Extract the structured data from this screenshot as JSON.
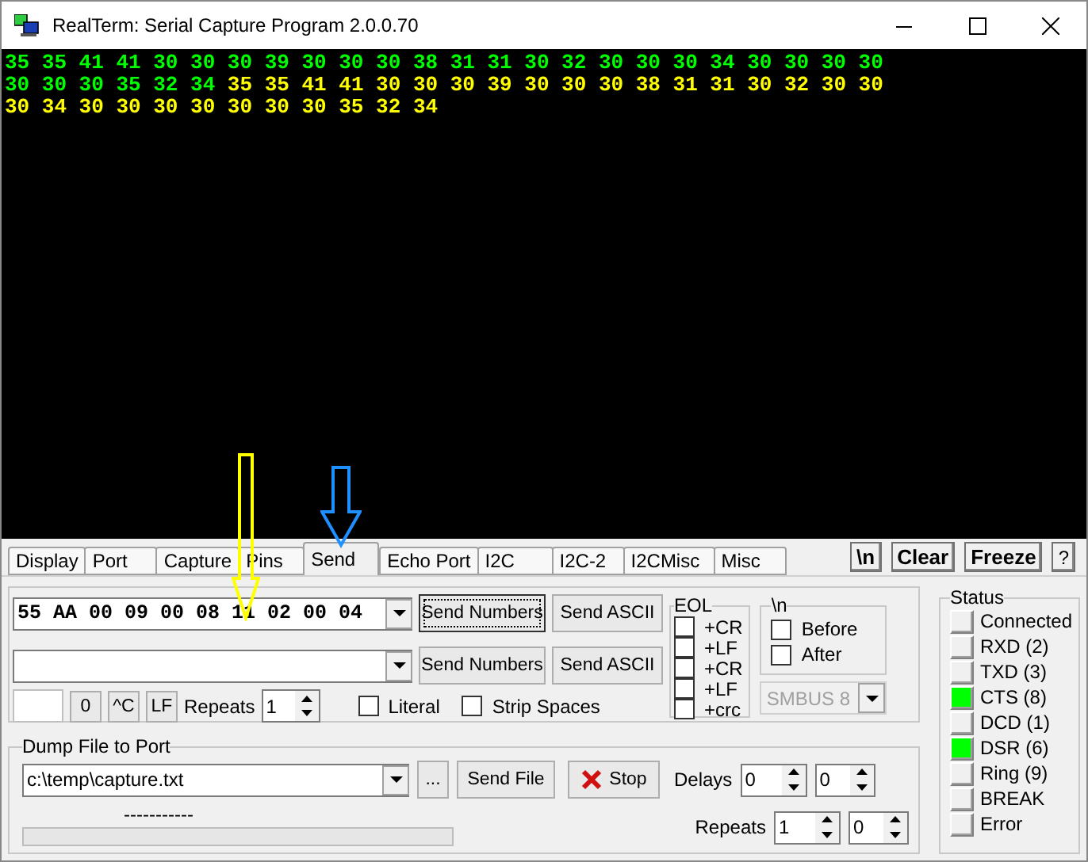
{
  "window": {
    "title": "RealTerm: Serial Capture Program 2.0.0.70"
  },
  "terminal": {
    "lines": [
      [
        {
          "text": "35 35 41 41 30 30 30 39 30 30 30 38 31 31 30 32 30 30 30 34 30 30 30 30",
          "color": "#00ff00"
        }
      ],
      [
        {
          "text": "30 30 30 35 32 34",
          "color": "#00ff00"
        },
        {
          "text": " 35 35 41 41 30 30 30 39 30 30 30 38 31 31 30 32 30 30",
          "color": "#ffff00"
        }
      ],
      [
        {
          "text": "30 34 30 30 30 30 30 30 30 35 32 34",
          "color": "#ffff00"
        }
      ]
    ]
  },
  "annotations": [
    {
      "color": "#ffff00"
    },
    {
      "color": "#1e90ff"
    }
  ],
  "tabs": [
    {
      "label": "Display",
      "selected": false
    },
    {
      "label": "Port",
      "selected": false
    },
    {
      "label": "Capture",
      "selected": false
    },
    {
      "label": "Pins",
      "selected": false
    },
    {
      "label": "Send",
      "selected": true
    },
    {
      "label": "Echo Port",
      "selected": false
    },
    {
      "label": "I2C",
      "selected": false
    },
    {
      "label": "I2C-2",
      "selected": false
    },
    {
      "label": "I2CMisc",
      "selected": false
    },
    {
      "label": "Misc",
      "selected": false
    }
  ],
  "toolbar_buttons": [
    "\\n",
    "Clear",
    "Freeze",
    "?"
  ],
  "send_rows": [
    {
      "value": "55 AA 00 09 00 08 11 02 00 04",
      "buttons": [
        {
          "label": "Send Numbers",
          "focused": true
        },
        {
          "label": "Send ASCII",
          "focused": false
        }
      ]
    },
    {
      "buttons": [
        {
          "label": "Send Numbers",
          "focused": false
        },
        {
          "label": "Send ASCII",
          "focused": false
        }
      ]
    }
  ],
  "control_chars": {
    "buttons": [
      "0",
      "^C",
      "LF"
    ],
    "repeats_label": "Repeats",
    "repeats": "1"
  },
  "options": [
    {
      "label": "Literal",
      "checked": false
    },
    {
      "label": "Strip Spaces",
      "checked": false
    }
  ],
  "eol": {
    "title": "EOL",
    "items": [
      {
        "label": "+CR",
        "checked": false
      },
      {
        "label": "+LF",
        "checked": false
      },
      {
        "label": "+CR",
        "checked": false
      },
      {
        "label": "+LF",
        "checked": false
      },
      {
        "label": "+crc",
        "checked": false
      }
    ]
  },
  "newline": {
    "title": "\\n",
    "items": [
      {
        "label": "Before",
        "checked": false
      },
      {
        "label": "After",
        "checked": false
      }
    ]
  },
  "smbus": {
    "value": "SMBUS 8",
    "disabled": true
  },
  "dump": {
    "title": "Dump File to Port",
    "file": "c:\\temp\\capture.txt",
    "browse": "...",
    "send_file": "Send File",
    "stop": "Stop",
    "delays_label": "Delays",
    "delays": [
      "0",
      "0"
    ],
    "progress_text": "-----------",
    "progress": {
      "level": 0
    },
    "repeats_label": "Repeats",
    "repeats": [
      "1",
      "0"
    ]
  },
  "status": {
    "title": "Status",
    "items": [
      {
        "label": "Connected",
        "on": false
      },
      {
        "label": "RXD (2)",
        "on": false
      },
      {
        "label": "TXD (3)",
        "on": false
      },
      {
        "label": "CTS (8)",
        "on": true
      },
      {
        "label": "DCD (1)",
        "on": false
      },
      {
        "label": "DSR (6)",
        "on": true
      },
      {
        "label": "Ring (9)",
        "on": false
      },
      {
        "label": "BREAK",
        "on": false
      },
      {
        "label": "Error",
        "on": false
      }
    ]
  }
}
